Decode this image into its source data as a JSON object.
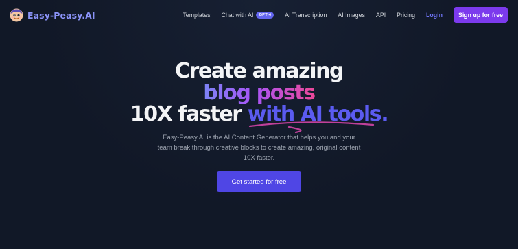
{
  "brand": {
    "name": "Easy-Peasy.AI",
    "logo_icon": "mascot-face-icon",
    "accent": "#8b93f8"
  },
  "nav": {
    "items": [
      {
        "label": "Templates"
      },
      {
        "label": "Chat with AI",
        "badge": "GPT-4"
      },
      {
        "label": "AI Transcription"
      },
      {
        "label": "AI Images"
      },
      {
        "label": "API"
      },
      {
        "label": "Pricing"
      }
    ],
    "login_label": "Login",
    "signup_label": "Sign up for free"
  },
  "hero": {
    "line1": "Create amazing",
    "line2": "blog posts",
    "line3_prefix": "10X faster",
    "line3_highlight": "with AI tools.",
    "description": "Easy-Peasy.AI is the AI Content Generator that helps you and your team break through creative blocks to create amazing, original content 10X faster.",
    "cta_label": "Get started for free"
  },
  "colors": {
    "background": "#111827",
    "primary": "#4f46e5",
    "signup": "#7c3aed",
    "highlight_text": "#5b5bf0",
    "underline": "#c0409a"
  }
}
